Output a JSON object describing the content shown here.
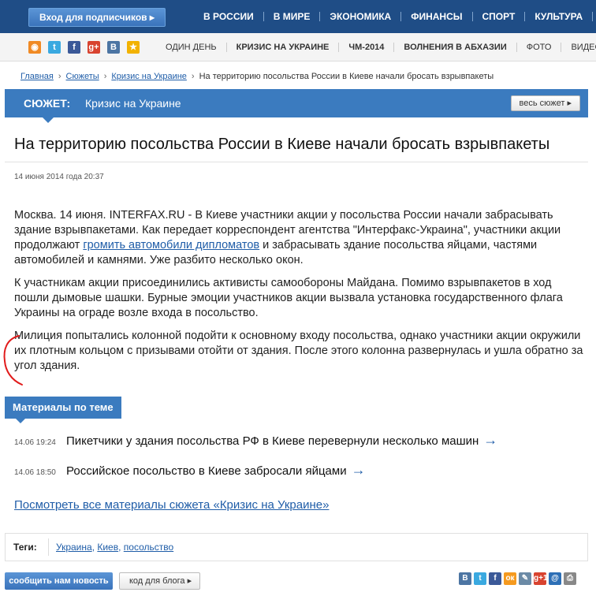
{
  "topbar": {
    "subscribe_label": "Вход для подписчиков",
    "nav": [
      "В РОССИИ",
      "В МИРЕ",
      "ЭКОНОМИКА",
      "ФИНАНСЫ",
      "СПОРТ",
      "КУЛЬТУРА",
      "МО"
    ]
  },
  "subbar": {
    "social": [
      {
        "name": "rss-icon",
        "glyph": "◉",
        "color": "#f08a24"
      },
      {
        "name": "twitter-icon",
        "glyph": "t",
        "color": "#3aa9e0"
      },
      {
        "name": "facebook-icon",
        "glyph": "f",
        "color": "#3b5998"
      },
      {
        "name": "googleplus-icon",
        "glyph": "g+",
        "color": "#d8432f"
      },
      {
        "name": "vkontakte-icon",
        "glyph": "В",
        "color": "#4c75a3"
      },
      {
        "name": "star-icon",
        "glyph": "★",
        "color": "#f2b200"
      }
    ],
    "nav": [
      {
        "label": "ОДИН ДЕНЬ",
        "bold": false
      },
      {
        "label": "КРИЗИС НА УКРАИНЕ",
        "bold": true
      },
      {
        "label": "ЧМ-2014",
        "bold": true
      },
      {
        "label": "ВОЛНЕНИЯ В АБХАЗИИ",
        "bold": true
      },
      {
        "label": "ФОТО",
        "bold": false
      },
      {
        "label": "ВИДЕО",
        "bold": false
      }
    ]
  },
  "breadcrumb": {
    "home": "Главная",
    "stories": "Сюжеты",
    "story": "Кризис на Украине",
    "current": "На территорию посольства России в Киеве начали бросать взрывпакеты"
  },
  "story": {
    "label": "СЮЖЕТ:",
    "title": "Кризис на Украине",
    "all_button": "весь сюжет"
  },
  "article": {
    "headline": "На территорию посольства России в Киеве начали бросать взрывпакеты",
    "date": "14 июня 2014 года 20:37",
    "p1_before": "Москва. 14 июня. INTERFAX.RU - В Киеве участники акции у посольства России начали забрасывать здание взрывпакетами. Как передает корреспондент агентства \"Интерфакс-Украина\", участники акции продолжают ",
    "p1_link": "громить автомобили дипломатов",
    "p1_after": " и забрасывать здание посольства яйцами, частями автомобилей и камнями. Уже разбито несколько окон.",
    "p2": "К участникам акции присоединились активисты самообороны Майдана. Помимо взрывпакетов в ход пошли дымовые шашки. Бурные эмоции участников акции вызвала установка государственного флага Украины на ограде возле входа в посольство.",
    "p3": "Милиция попытались колонной подойти к основному входу посольства, однако участники акции окружили их плотным кольцом с призывами отойти от здания. После этого колонна развернулась и ушла обратно за угол здания."
  },
  "related": {
    "header": "Материалы по теме",
    "items": [
      {
        "time": "14.06 19:24",
        "title": "Пикетчики у здания посольства РФ в Киеве перевернули несколько машин",
        "arrow": "→"
      },
      {
        "time": "14.06 18:50",
        "title": "Российское посольство в Киеве забросали яйцами",
        "arrow": "→"
      }
    ],
    "all_link": "Посмотреть все материалы сюжета «Кризис на Украине»"
  },
  "tags": {
    "label": "Теги:",
    "items": [
      "Украина",
      "Киев",
      "посольство"
    ],
    "separator": ", "
  },
  "footer": {
    "send_news": "сообщить нам новость",
    "blog_code": "код для блога",
    "share": [
      {
        "name": "vk-share-icon",
        "glyph": "В",
        "color": "#4c75a3"
      },
      {
        "name": "twitter-share-icon",
        "glyph": "t",
        "color": "#3aa9e0"
      },
      {
        "name": "facebook-share-icon",
        "glyph": "f",
        "color": "#3b5998"
      },
      {
        "name": "odnoklassniki-share-icon",
        "glyph": "ок",
        "color": "#f59a1f"
      },
      {
        "name": "livejournal-share-icon",
        "glyph": "✎",
        "color": "#6b8aa6"
      },
      {
        "name": "gplus-share-icon",
        "glyph": "g+1",
        "color": "#d8432f"
      },
      {
        "name": "mail-share-icon",
        "glyph": "@",
        "color": "#2d6fb6"
      },
      {
        "name": "print-share-icon",
        "glyph": "⎙",
        "color": "#888888"
      }
    ]
  },
  "colors": {
    "topbar": "#1f4d86",
    "accent": "#3b7bbf",
    "link": "#1f5da8",
    "annotation": "#e11b1b"
  }
}
